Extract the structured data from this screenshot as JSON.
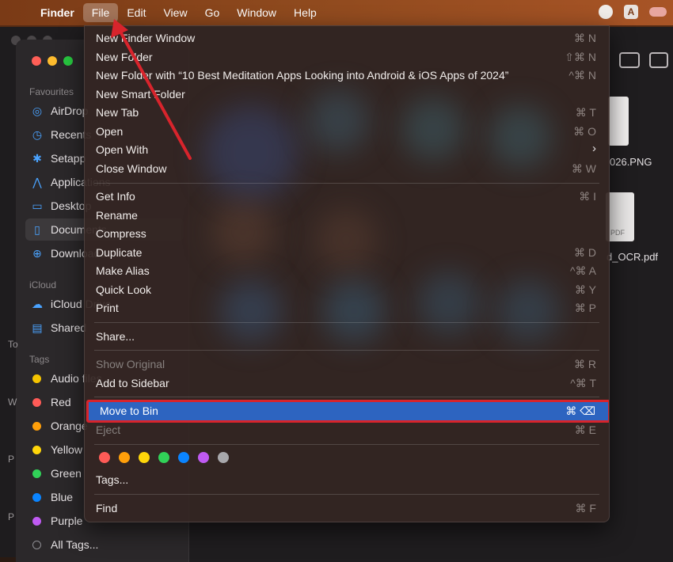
{
  "menubar": {
    "app": "Finder",
    "items": [
      "File",
      "Edit",
      "View",
      "Go",
      "Window",
      "Help"
    ],
    "active": "File"
  },
  "sidebar": {
    "sections": {
      "favourites": "Favourites",
      "icloud": "iCloud",
      "tags": "Tags"
    },
    "favourites": [
      {
        "label": "AirDrop",
        "icon": "airdrop-icon"
      },
      {
        "label": "Recents",
        "icon": "clock-icon"
      },
      {
        "label": "Setapp",
        "icon": "setapp-icon"
      },
      {
        "label": "Applications",
        "icon": "applications-icon"
      },
      {
        "label": "Desktop",
        "icon": "desktop-icon"
      },
      {
        "label": "Documents",
        "icon": "document-icon"
      },
      {
        "label": "Downloads",
        "icon": "download-icon"
      }
    ],
    "icloud": [
      {
        "label": "iCloud Drive",
        "icon": "cloud-icon"
      },
      {
        "label": "Shared",
        "icon": "shared-folder-icon"
      }
    ],
    "tags": [
      {
        "label": "Audio files",
        "color": "#f5c400"
      },
      {
        "label": "Red",
        "color": "#ff5b57"
      },
      {
        "label": "Orange",
        "color": "#ff9f0a"
      },
      {
        "label": "Yellow",
        "color": "#ffd60a"
      },
      {
        "label": "Green",
        "color": "#31d158"
      },
      {
        "label": "Blue",
        "color": "#0a84ff"
      },
      {
        "label": "Purple",
        "color": "#bf5af2"
      },
      {
        "label": "All Tags...",
        "color": "#8e8e93"
      }
    ],
    "edge_letters": [
      "To",
      "W",
      "P",
      "P"
    ]
  },
  "content": {
    "files": [
      "026.PNG",
      "d_OCR.pdf"
    ],
    "pdf_badge": "PDF"
  },
  "file_menu": {
    "items": [
      {
        "label": "New Finder Window",
        "shortcut": "⌘ N"
      },
      {
        "label": "New Folder",
        "shortcut": "⇧⌘ N"
      },
      {
        "label": "New Folder with “10 Best Meditation Apps Looking into Android & iOS Apps of 2024”",
        "shortcut": "^⌘ N"
      },
      {
        "label": "New Smart Folder",
        "shortcut": ""
      },
      {
        "label": "New Tab",
        "shortcut": "⌘ T"
      },
      {
        "label": "Open",
        "shortcut": "⌘ O"
      },
      {
        "label": "Open With",
        "shortcut": ""
      },
      {
        "label": "Close Window",
        "shortcut": "⌘ W"
      },
      {
        "label": "Get Info",
        "shortcut": "⌘ I"
      },
      {
        "label": "Rename",
        "shortcut": ""
      },
      {
        "label": "Compress",
        "shortcut": ""
      },
      {
        "label": "Duplicate",
        "shortcut": "⌘ D"
      },
      {
        "label": "Make Alias",
        "shortcut": "^⌘ A"
      },
      {
        "label": "Quick Look",
        "shortcut": "⌘ Y"
      },
      {
        "label": "Print",
        "shortcut": "⌘ P"
      },
      {
        "label": "Share...",
        "shortcut": ""
      },
      {
        "label": "Show Original",
        "shortcut": "⌘ R"
      },
      {
        "label": "Add to Sidebar",
        "shortcut": "^⌘ T"
      },
      {
        "label": "Move to Bin",
        "shortcut": "⌘ ⌫"
      },
      {
        "label": "Eject",
        "shortcut": "⌘ E"
      },
      {
        "label": "Tags...",
        "shortcut": ""
      },
      {
        "label": "Find",
        "shortcut": "⌘ F"
      }
    ],
    "tag_colors": [
      "#ff5b57",
      "#ff9f0a",
      "#ffd60a",
      "#31d158",
      "#0a84ff",
      "#bf5af2",
      "#a8a8ac"
    ],
    "highlighted": "Move to Bin"
  }
}
